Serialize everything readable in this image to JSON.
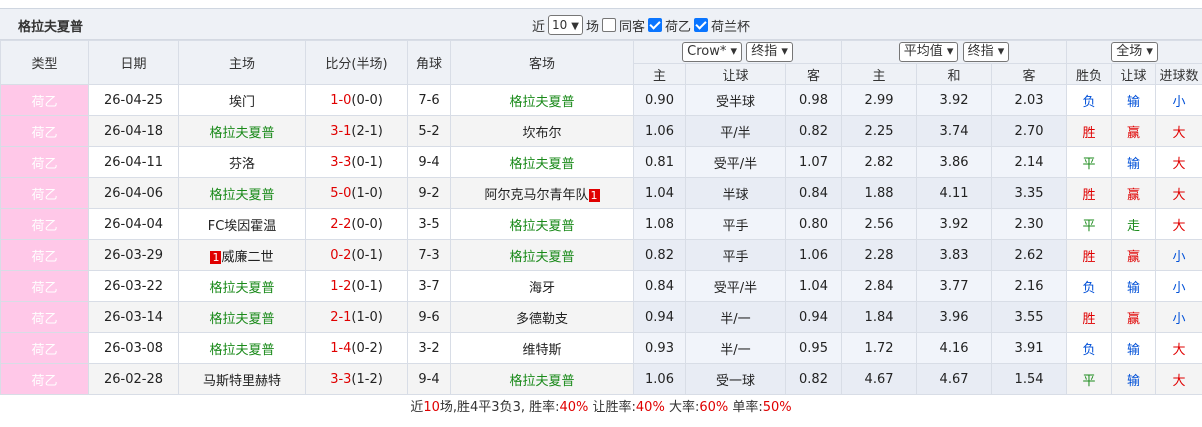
{
  "title": "格拉夫夏普",
  "controls": {
    "recent_label": "近",
    "recent_count": "10",
    "unit_label": "场",
    "same_home_label": "同客",
    "same_home_checked": false,
    "league1_label": "荷乙",
    "league1_checked": true,
    "league2_label": "荷兰杯",
    "league2_checked": true
  },
  "headers": {
    "type": "类型",
    "date": "日期",
    "home": "主场",
    "score": "比分(半场)",
    "corner": "角球",
    "away": "客场",
    "company_select": "Crow*",
    "handicap_mode_select": "终指",
    "avg_select": "平均值",
    "euro_mode_select": "终指",
    "scope_select": "全场",
    "sub_home": "主",
    "sub_handicap": "让球",
    "sub_away": "客",
    "sub_euro_home": "主",
    "sub_euro_draw": "和",
    "sub_euro_away": "客",
    "sub_result": "胜负",
    "sub_handicap_result": "让球",
    "sub_goals": "进球数"
  },
  "rows": [
    {
      "league": "荷乙",
      "date": "26-04-25",
      "home": "埃门",
      "home_team": false,
      "home_badge": "",
      "score": "1-0",
      "half": "(0-0)",
      "corner": "7-6",
      "away": "格拉夫夏普",
      "away_team": true,
      "away_badge": "",
      "o_home": "0.90",
      "o_hcp": "受半球",
      "o_away": "0.98",
      "e_home": "2.99",
      "e_draw": "3.92",
      "e_away": "2.03",
      "res": "负",
      "res_color": "blue",
      "hres": "输",
      "hres_color": "blue",
      "goals": "小",
      "goals_color": "blue"
    },
    {
      "league": "荷乙",
      "date": "26-04-18",
      "home": "格拉夫夏普",
      "home_team": true,
      "home_badge": "",
      "score": "3-1",
      "half": "(2-1)",
      "corner": "5-2",
      "away": "坎布尔",
      "away_team": false,
      "away_badge": "",
      "o_home": "1.06",
      "o_hcp": "平/半",
      "o_away": "0.82",
      "e_home": "2.25",
      "e_draw": "3.74",
      "e_away": "2.70",
      "res": "胜",
      "res_color": "red",
      "hres": "赢",
      "hres_color": "red",
      "goals": "大",
      "goals_color": "red"
    },
    {
      "league": "荷乙",
      "date": "26-04-11",
      "home": "芬洛",
      "home_team": false,
      "home_badge": "",
      "score": "3-3",
      "half": "(0-1)",
      "corner": "9-4",
      "away": "格拉夫夏普",
      "away_team": true,
      "away_badge": "",
      "o_home": "0.81",
      "o_hcp": "受平/半",
      "o_away": "1.07",
      "e_home": "2.82",
      "e_draw": "3.86",
      "e_away": "2.14",
      "res": "平",
      "res_color": "green",
      "hres": "输",
      "hres_color": "blue",
      "goals": "大",
      "goals_color": "red"
    },
    {
      "league": "荷乙",
      "date": "26-04-06",
      "home": "格拉夫夏普",
      "home_team": true,
      "home_badge": "",
      "score": "5-0",
      "half": "(1-0)",
      "corner": "9-2",
      "away": "阿尔克马尔青年队",
      "away_team": false,
      "away_badge": "1",
      "o_home": "1.04",
      "o_hcp": "半球",
      "o_away": "0.84",
      "e_home": "1.88",
      "e_draw": "4.11",
      "e_away": "3.35",
      "res": "胜",
      "res_color": "red",
      "hres": "赢",
      "hres_color": "red",
      "goals": "大",
      "goals_color": "red"
    },
    {
      "league": "荷乙",
      "date": "26-04-04",
      "home": "FC埃因霍温",
      "home_team": false,
      "home_badge": "",
      "score": "2-2",
      "half": "(0-0)",
      "corner": "3-5",
      "away": "格拉夫夏普",
      "away_team": true,
      "away_badge": "",
      "o_home": "1.08",
      "o_hcp": "平手",
      "o_away": "0.80",
      "e_home": "2.56",
      "e_draw": "3.92",
      "e_away": "2.30",
      "res": "平",
      "res_color": "green",
      "hres": "走",
      "hres_color": "green",
      "goals": "大",
      "goals_color": "red"
    },
    {
      "league": "荷乙",
      "date": "26-03-29",
      "home": "威廉二世",
      "home_team": false,
      "home_badge": "1",
      "score": "0-2",
      "half": "(0-1)",
      "corner": "7-3",
      "away": "格拉夫夏普",
      "away_team": true,
      "away_badge": "",
      "o_home": "0.82",
      "o_hcp": "平手",
      "o_away": "1.06",
      "e_home": "2.28",
      "e_draw": "3.83",
      "e_away": "2.62",
      "res": "胜",
      "res_color": "red",
      "hres": "赢",
      "hres_color": "red",
      "goals": "小",
      "goals_color": "blue"
    },
    {
      "league": "荷乙",
      "date": "26-03-22",
      "home": "格拉夫夏普",
      "home_team": true,
      "home_badge": "",
      "score": "1-2",
      "half": "(0-1)",
      "corner": "3-7",
      "away": "海牙",
      "away_team": false,
      "away_badge": "",
      "o_home": "0.84",
      "o_hcp": "受平/半",
      "o_away": "1.04",
      "e_home": "2.84",
      "e_draw": "3.77",
      "e_away": "2.16",
      "res": "负",
      "res_color": "blue",
      "hres": "输",
      "hres_color": "blue",
      "goals": "小",
      "goals_color": "blue"
    },
    {
      "league": "荷乙",
      "date": "26-03-14",
      "home": "格拉夫夏普",
      "home_team": true,
      "home_badge": "",
      "score": "2-1",
      "half": "(1-0)",
      "corner": "9-6",
      "away": "多德勒支",
      "away_team": false,
      "away_badge": "",
      "o_home": "0.94",
      "o_hcp": "半/一",
      "o_away": "0.94",
      "e_home": "1.84",
      "e_draw": "3.96",
      "e_away": "3.55",
      "res": "胜",
      "res_color": "red",
      "hres": "赢",
      "hres_color": "red",
      "goals": "小",
      "goals_color": "blue"
    },
    {
      "league": "荷乙",
      "date": "26-03-08",
      "home": "格拉夫夏普",
      "home_team": true,
      "home_badge": "",
      "score": "1-4",
      "half": "(0-2)",
      "corner": "3-2",
      "away": "维特斯",
      "away_team": false,
      "away_badge": "",
      "o_home": "0.93",
      "o_hcp": "半/一",
      "o_away": "0.95",
      "e_home": "1.72",
      "e_draw": "4.16",
      "e_away": "3.91",
      "res": "负",
      "res_color": "blue",
      "hres": "输",
      "hres_color": "blue",
      "goals": "大",
      "goals_color": "red"
    },
    {
      "league": "荷乙",
      "date": "26-02-28",
      "home": "马斯特里赫特",
      "home_team": false,
      "home_badge": "",
      "score": "3-3",
      "half": "(1-2)",
      "corner": "9-4",
      "away": "格拉夫夏普",
      "away_team": true,
      "away_badge": "",
      "o_home": "1.06",
      "o_hcp": "受一球",
      "o_away": "0.82",
      "e_home": "4.67",
      "e_draw": "4.67",
      "e_away": "1.54",
      "res": "平",
      "res_color": "green",
      "hres": "输",
      "hres_color": "blue",
      "goals": "大",
      "goals_color": "red"
    }
  ],
  "summary": {
    "prefix": "近",
    "matches": "10",
    "mid": "场,胜4平3负3, 胜率:",
    "win_rate": "40%",
    "hcp_label": " 让胜率:",
    "hcp_rate": "40%",
    "big_label": " 大率:",
    "big_rate": "60%",
    "odd_label": " 单率:",
    "odd_rate": "50%"
  },
  "colors": {
    "team": "#1a8a1a",
    "score": "#e00000",
    "league_bg": "#ffc8e8"
  }
}
